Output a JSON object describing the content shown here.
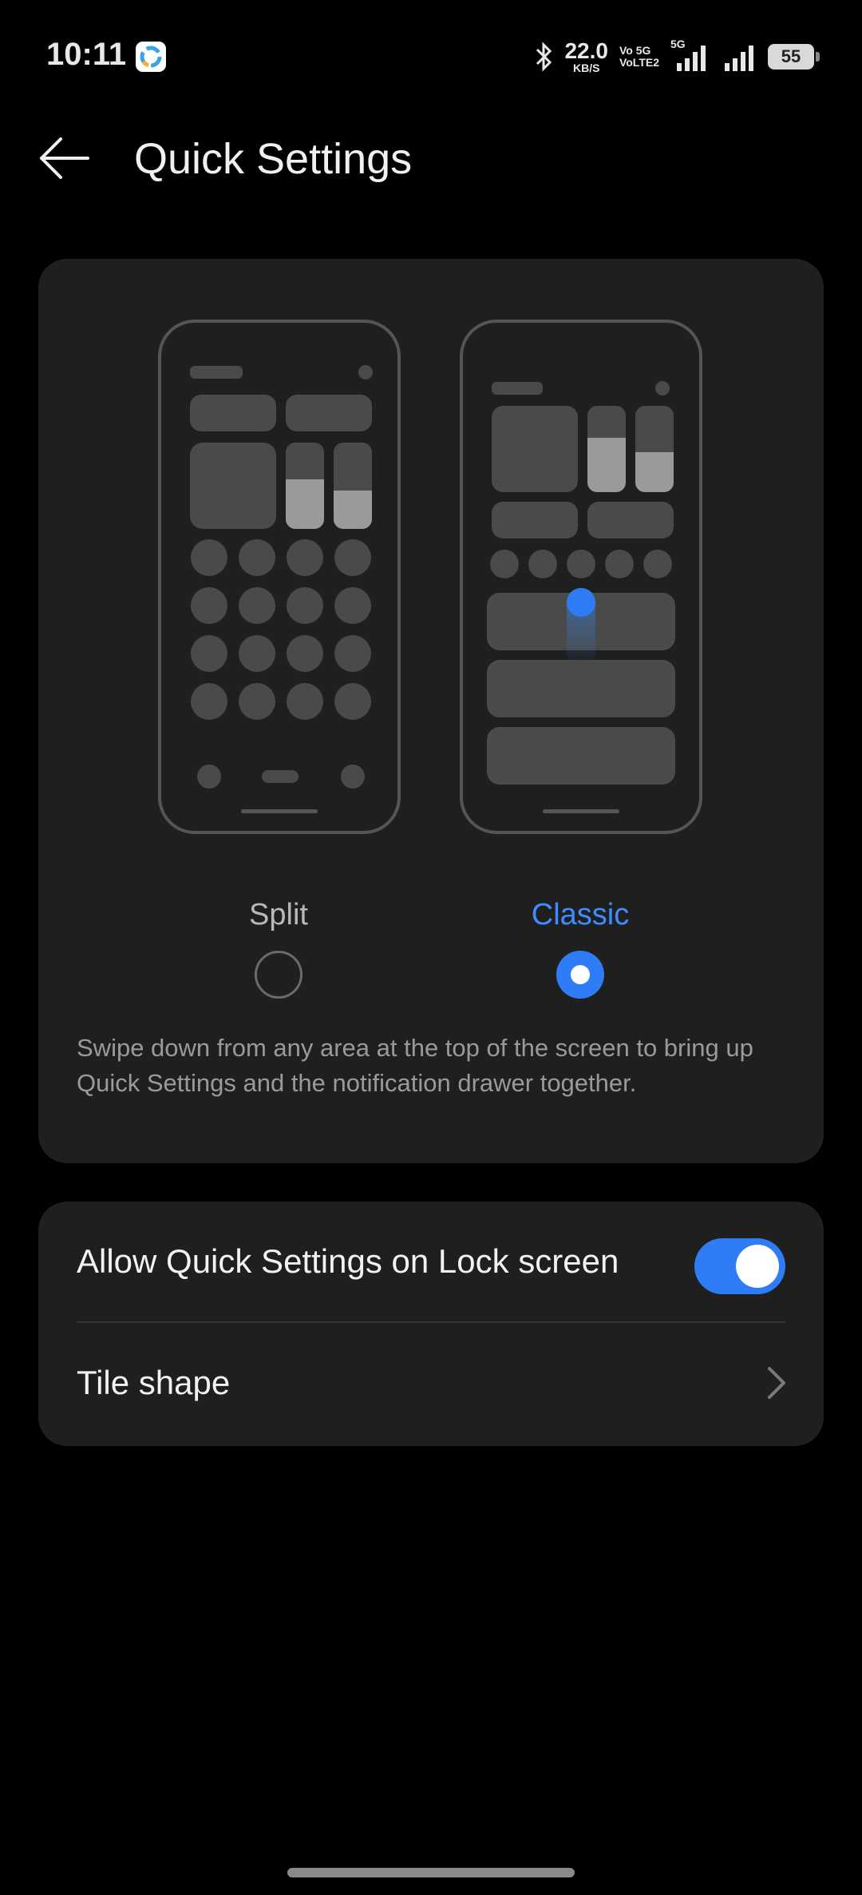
{
  "status_bar": {
    "time": "10:11",
    "net_speed": "22.0",
    "net_unit": "KB/S",
    "volte_top": "Vo 5G",
    "volte_bottom": "VoLTE2",
    "network": "5G",
    "battery": "55"
  },
  "header": {
    "title": "Quick Settings",
    "back_icon": "arrow-left-icon"
  },
  "layout_card": {
    "options": [
      {
        "label": "Split",
        "selected": false
      },
      {
        "label": "Classic",
        "selected": true
      }
    ],
    "description": "Swipe down from any area at the top of the screen to bring up Quick Settings and the notification drawer together."
  },
  "settings": {
    "lock_screen_label": "Allow Quick Settings on Lock screen",
    "lock_screen_enabled": true,
    "tile_shape_label": "Tile shape"
  },
  "colors": {
    "accent": "#2f7df6",
    "card": "#1f1f1f",
    "background": "#000000"
  }
}
